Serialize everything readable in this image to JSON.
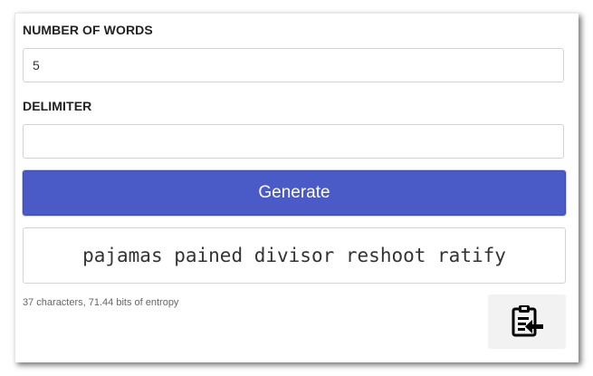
{
  "form": {
    "number_of_words_label": "NUMBER OF WORDS",
    "number_of_words_value": "5",
    "delimiter_label": "DELIMITER",
    "delimiter_value": "",
    "generate_label": "Generate"
  },
  "result": {
    "passphrase": "pajamas pained divisor reshoot ratify",
    "stats": "37 characters, 71.44 bits of entropy"
  },
  "actions": {
    "copy_icon": "clipboard-paste-icon"
  },
  "colors": {
    "accent": "#4a5bc8",
    "text": "#333333"
  }
}
